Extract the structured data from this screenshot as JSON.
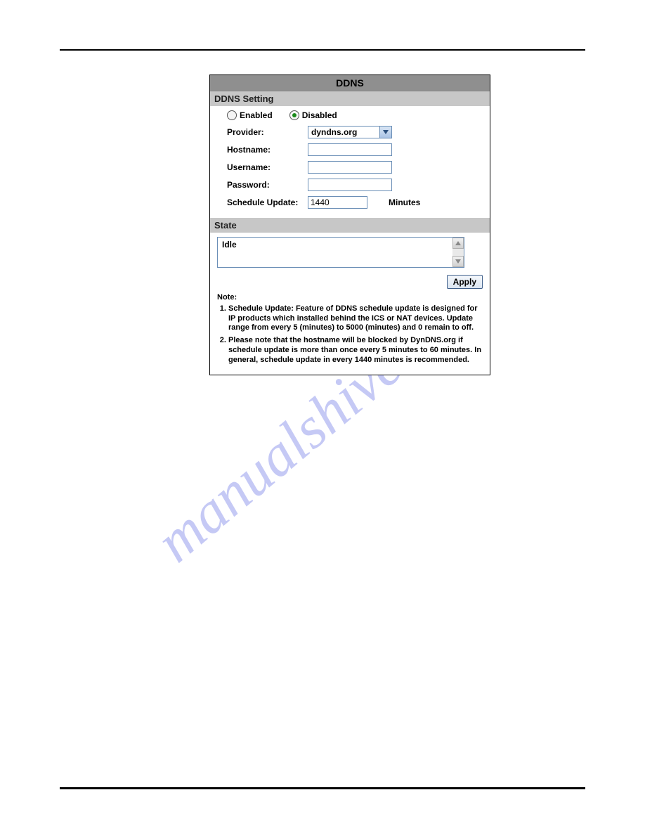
{
  "panel": {
    "title": "DDNS",
    "setting_header": "DDNS Setting",
    "enabled_label": "Enabled",
    "disabled_label": "Disabled",
    "selected": "disabled",
    "provider_label": "Provider:",
    "provider_value": "dyndns.org",
    "hostname_label": "Hostname:",
    "hostname_value": "",
    "username_label": "Username:",
    "username_value": "",
    "password_label": "Password:",
    "password_value": "",
    "schedule_label": "Schedule Update:",
    "schedule_value": "1440",
    "schedule_unit": "Minutes",
    "state_header": "State",
    "state_value": "Idle",
    "apply_label": "Apply",
    "note_title": "Note:",
    "notes": [
      "Schedule Update: Feature of DDNS schedule update is designed for IP products which installed behind the ICS or NAT devices. Update range from every 5 (minutes) to 5000 (minutes) and 0 remain to off.",
      "Please note that the hostname will be blocked by DynDNS.org if schedule update is more than once every 5 minutes to 60 minutes. In general, schedule update in every 1440 minutes is recommended."
    ]
  },
  "watermark": "manualshive.com"
}
